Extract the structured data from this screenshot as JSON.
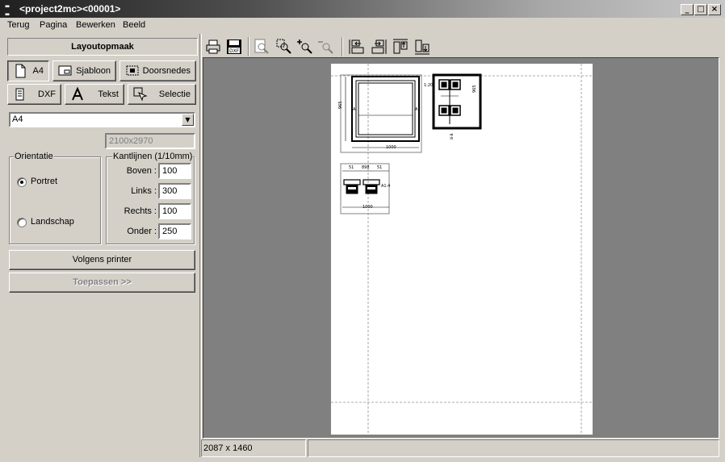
{
  "window": {
    "title": "<project2mc><00001>",
    "buttons": {
      "minimize": "_",
      "maximize": "□",
      "close": "×"
    }
  },
  "menu": [
    "Terug",
    "Pagina",
    "Bewerken",
    "Beeld"
  ],
  "panel": {
    "title": "Layoutopmaak",
    "mode_buttons": [
      {
        "label": "A4",
        "icon": "page-icon",
        "pressed": true
      },
      {
        "label": "Sjabloon",
        "icon": "template-icon",
        "pressed": false
      },
      {
        "label": "Doorsnedes",
        "icon": "section-icon",
        "pressed": false
      },
      {
        "label": "DXF",
        "icon": "dxf-icon",
        "pressed": false
      },
      {
        "label": "Tekst",
        "icon": "text-icon",
        "pressed": false
      },
      {
        "label": "Selectie",
        "icon": "select-cursor-icon",
        "pressed": false
      }
    ],
    "paper_size": {
      "selected": "A4",
      "dimensions": "2100x2970"
    },
    "orientation": {
      "label": "Orientatie",
      "options": [
        {
          "label": "Portret",
          "checked": true
        },
        {
          "label": "Landschap",
          "checked": false
        }
      ]
    },
    "margins": {
      "label": "Kantlijnen (1/10mm)",
      "fields": [
        {
          "label": "Boven :",
          "value": "100"
        },
        {
          "label": "Links :",
          "value": "300"
        },
        {
          "label": "Rechts :",
          "value": "100"
        },
        {
          "label": "Onder :",
          "value": "250"
        }
      ]
    },
    "printer_button": "Volgens printer",
    "apply_button": "Toepassen >>"
  },
  "toolbar": [
    "print-icon",
    "save-dxf-icon",
    "zoom-page-icon",
    "zoom-window-icon",
    "zoom-in-icon",
    "zoom-out-icon",
    "align-left-icon",
    "align-right-icon",
    "align-top-icon",
    "align-bottom-icon"
  ],
  "drawing": {
    "frame_width": "1000",
    "frame_height": "965",
    "frame_mark": "A",
    "detail_scale": "1:20",
    "detail_height": "965",
    "detail_section": "B-B",
    "section_dims": [
      "51",
      "898",
      "51"
    ],
    "section_scale": "A1:4",
    "section_width": "1000"
  },
  "status": {
    "size": "2087 x 1460",
    "message": ""
  }
}
